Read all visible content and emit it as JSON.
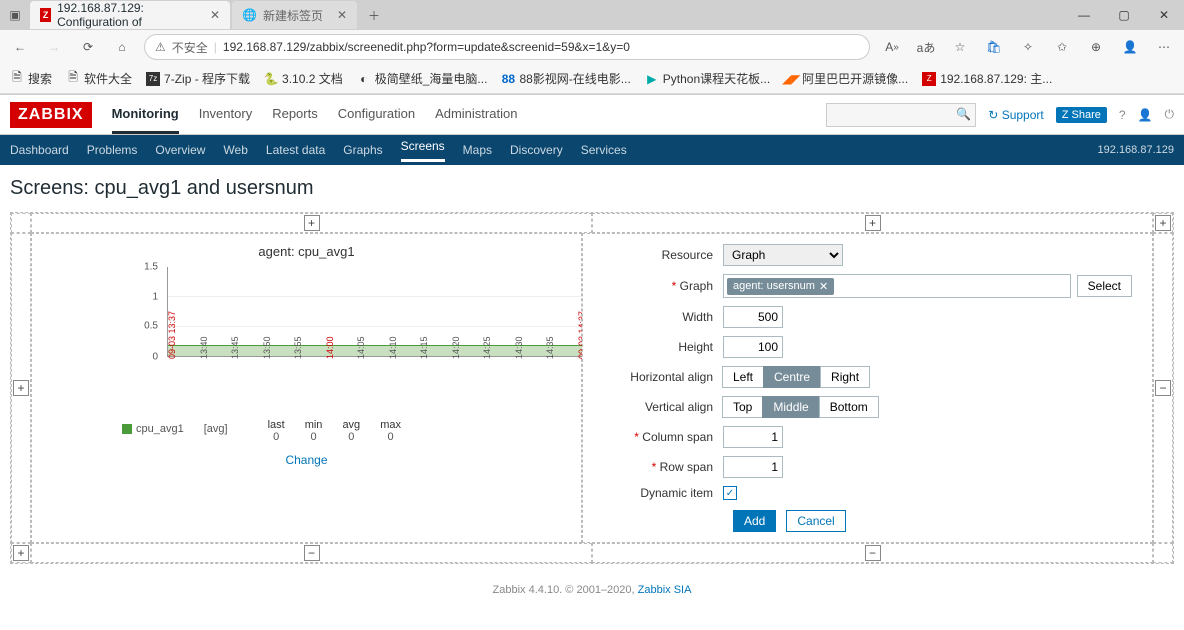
{
  "browser": {
    "tabs": [
      {
        "title": "192.168.87.129: Configuration of",
        "active": true
      },
      {
        "title": "新建标签页",
        "active": false
      }
    ],
    "security_label": "不安全",
    "url": "192.168.87.129/zabbix/screenedit.php?form=update&screenid=59&x=1&y=0",
    "bookmarks": [
      "搜索",
      "软件大全",
      "7-Zip - 程序下载",
      "3.10.2 文档",
      "极简壁纸_海量电脑...",
      "88影视网-在线电影...",
      "Python课程天花板...",
      "阿里巴巴开源镜像...",
      "192.168.87.129: 主..."
    ]
  },
  "zabbix": {
    "logo": "ZABBIX",
    "menu": [
      "Monitoring",
      "Inventory",
      "Reports",
      "Configuration",
      "Administration"
    ],
    "active_menu": "Monitoring",
    "support": "Support",
    "share": "Share",
    "submenu": [
      "Dashboard",
      "Problems",
      "Overview",
      "Web",
      "Latest data",
      "Graphs",
      "Screens",
      "Maps",
      "Discovery",
      "Services"
    ],
    "active_submenu": "Screens",
    "host_ip": "192.168.87.129"
  },
  "page": {
    "title": "Screens: cpu_avg1 and usersnum"
  },
  "chart_data": {
    "type": "area",
    "title": "agent: cpu_avg1",
    "ylim": [
      0,
      1.5
    ],
    "yticks": [
      0,
      0.5,
      1.0,
      1.5
    ],
    "x": [
      "09-03 13:37",
      "13:40",
      "13:45",
      "13:50",
      "13:55",
      "14:00",
      "14:05",
      "14:10",
      "14:15",
      "14:20",
      "14:25",
      "14:30",
      "14:35",
      "09-03 14:37"
    ],
    "series": [
      {
        "name": "cpu_avg1",
        "agg": "[avg]",
        "color": "#4b9b3a",
        "last": 0,
        "min": 0,
        "avg": 0,
        "max": 0
      }
    ],
    "change_label": "Change"
  },
  "form": {
    "labels": {
      "resource": "Resource",
      "graph": "Graph",
      "width": "Width",
      "height": "Height",
      "halign": "Horizontal align",
      "valign": "Vertical align",
      "colspan": "Column span",
      "rowspan": "Row span",
      "dynamic": "Dynamic item",
      "select": "Select",
      "add": "Add",
      "cancel": "Cancel"
    },
    "resource_value": "Graph",
    "graph_tag": "agent: usersnum",
    "width": "500",
    "height": "100",
    "halign": [
      "Left",
      "Centre",
      "Right"
    ],
    "halign_active": "Centre",
    "valign": [
      "Top",
      "Middle",
      "Bottom"
    ],
    "valign_active": "Middle",
    "colspan": "1",
    "rowspan": "1",
    "dynamic_checked": true
  },
  "footer": {
    "text": "Zabbix 4.4.10. © 2001–2020, ",
    "link": "Zabbix SIA"
  }
}
